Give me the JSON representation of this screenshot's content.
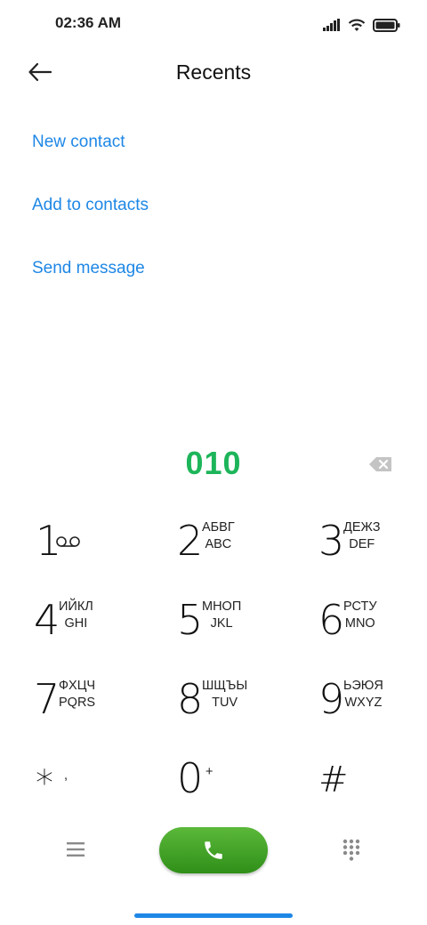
{
  "status_bar": {
    "time": "02:36 AM",
    "icons": [
      "signal-icon",
      "wifi-icon",
      "battery-icon"
    ]
  },
  "header": {
    "title": "Recents",
    "back_icon": "arrow-left-icon"
  },
  "actions": [
    {
      "label": "New contact"
    },
    {
      "label": "Add to contacts"
    },
    {
      "label": "Send message"
    }
  ],
  "dialer": {
    "number": "010",
    "backspace_icon": "backspace-icon"
  },
  "keys": [
    {
      "digit": "1",
      "letters_top": "",
      "letters_bottom": "",
      "icon": "voicemail-icon"
    },
    {
      "digit": "2",
      "letters_top": "АБВГ",
      "letters_bottom": "ABC"
    },
    {
      "digit": "3",
      "letters_top": "ДЕЖЗ",
      "letters_bottom": "DEF"
    },
    {
      "digit": "4",
      "letters_top": "ИЙКЛ",
      "letters_bottom": "GHI"
    },
    {
      "digit": "5",
      "letters_top": "МНОП",
      "letters_bottom": "JKL"
    },
    {
      "digit": "6",
      "letters_top": "РСТУ",
      "letters_bottom": "MNO"
    },
    {
      "digit": "7",
      "letters_top": "ФХЦЧ",
      "letters_bottom": "PQRS"
    },
    {
      "digit": "8",
      "letters_top": "ШЩЪЫ",
      "letters_bottom": "TUV"
    },
    {
      "digit": "9",
      "letters_top": "ЬЭЮЯ",
      "letters_bottom": "WXYZ"
    },
    {
      "digit": "*",
      "letters_top": ",",
      "letters_bottom": ""
    },
    {
      "digit": "0",
      "letters_top": "+",
      "letters_bottom": ""
    },
    {
      "digit": "#",
      "letters_top": "",
      "letters_bottom": ""
    }
  ],
  "bottom_bar": {
    "menu_icon": "menu-icon",
    "call_icon": "phone-icon",
    "dialpad_icon": "dialpad-icon"
  },
  "colors": {
    "accent": "#1e87e6",
    "number": "#1db55a",
    "call_button": "#3f9f22"
  }
}
